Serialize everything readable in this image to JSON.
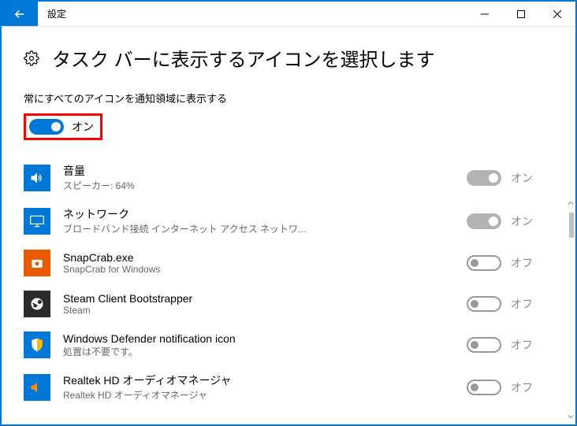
{
  "titlebar": {
    "title": "設定"
  },
  "page": {
    "title": "タスク バーに表示するアイコンを選択します",
    "section_label": "常にすべてのアイコンを通知領域に表示する"
  },
  "main_toggle": {
    "state": "on",
    "label": "オン"
  },
  "items": [
    {
      "title": "音量",
      "sub": "スピーカー: 64%",
      "toggle_state": "on",
      "toggle_label": "オン",
      "disabled": true,
      "icon": "volume",
      "icon_bg": "blue"
    },
    {
      "title": "ネットワーク",
      "sub": "ブロードバンド接続 インターネット アクセス   ネットワ...",
      "toggle_state": "on",
      "toggle_label": "オン",
      "disabled": true,
      "icon": "network",
      "icon_bg": "blue"
    },
    {
      "title": "SnapCrab.exe",
      "sub": "SnapCrab for Windows",
      "toggle_state": "off",
      "toggle_label": "オフ",
      "disabled": true,
      "icon": "snapcrab",
      "icon_bg": "orange"
    },
    {
      "title": "Steam Client Bootstrapper",
      "sub": "Steam",
      "toggle_state": "off",
      "toggle_label": "オフ",
      "disabled": true,
      "icon": "steam",
      "icon_bg": "dark"
    },
    {
      "title": "Windows Defender notification icon",
      "sub": "処置は不要です。",
      "toggle_state": "off",
      "toggle_label": "オフ",
      "disabled": true,
      "icon": "defender",
      "icon_bg": "blue"
    },
    {
      "title": "Realtek HD オーディオマネージャ",
      "sub": "Realtek HD オーディオマネージャ",
      "toggle_state": "off",
      "toggle_label": "オフ",
      "disabled": true,
      "icon": "realtek",
      "icon_bg": "blue"
    }
  ]
}
